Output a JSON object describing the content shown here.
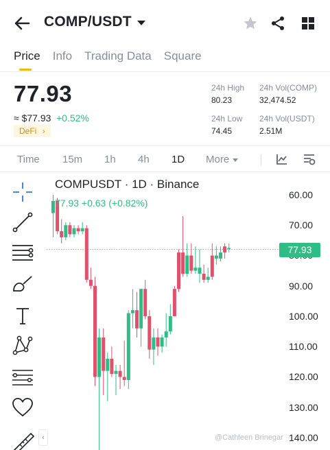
{
  "header": {
    "pair": "COMP/USDT",
    "icons": [
      "back-arrow-icon",
      "caret-down-icon",
      "star-icon",
      "share-icon",
      "grid-icon"
    ]
  },
  "tabs": [
    "Price",
    "Info",
    "Trading Data",
    "Square"
  ],
  "ticker": {
    "last_price": "77.93",
    "fiat_price": "≈ $77.93",
    "change_pct": "+0.52%",
    "tag": "DeFi",
    "high_label": "24h High",
    "high_value": "80.23",
    "low_label": "24h Low",
    "low_value": "74.45",
    "vol_base_label": "24h Vol(COMP)",
    "vol_base_value": "32,474.52",
    "vol_quote_label": "24h Vol(USDT)",
    "vol_quote_value": "2.51M"
  },
  "intervals": [
    "Time",
    "15m",
    "1h",
    "4h",
    "1D",
    "More"
  ],
  "active_interval": "1D",
  "tools": [
    "crosshair-icon",
    "trend-line-icon",
    "horizontal-lines-icon",
    "brush-icon",
    "text-icon",
    "pattern-icon",
    "fib-icon",
    "heart-icon",
    "ruler-icon"
  ],
  "chart": {
    "title": "COMPUSDT · 1D · Binance",
    "subtitle": "77.93 +0.63 (+0.82%)",
    "current_price_tag": "77.93",
    "y_ticks": [
      "60.00",
      "70.00",
      "80.00",
      "90.00",
      "100.00",
      "110.00",
      "120.00",
      "130.00",
      "140.00"
    ],
    "watermark": "@Cathleen Brinegar",
    "colors": {
      "up": "#2ebd85",
      "down": "#e0526b",
      "accent": "#f0b90b"
    }
  },
  "chart_data": {
    "type": "candlestick",
    "title": "COMPUSDT · 1D · Binance",
    "ylim": [
      140,
      57
    ],
    "y_inverted": true,
    "current": 77.93,
    "candles": [
      {
        "o": 66,
        "h": 60,
        "l": 74,
        "c": 62,
        "up": true
      },
      {
        "o": 62,
        "h": 61,
        "l": 73,
        "c": 72,
        "up": false
      },
      {
        "o": 72,
        "h": 68,
        "l": 76,
        "c": 74,
        "up": false
      },
      {
        "o": 74,
        "h": 69,
        "l": 75,
        "c": 70,
        "up": true
      },
      {
        "o": 70,
        "h": 69,
        "l": 74,
        "c": 73,
        "up": false
      },
      {
        "o": 73,
        "h": 70,
        "l": 74,
        "c": 71,
        "up": true
      },
      {
        "o": 71,
        "h": 70,
        "l": 73,
        "c": 72,
        "up": false
      },
      {
        "o": 72,
        "h": 69,
        "l": 73,
        "c": 71,
        "up": true
      },
      {
        "o": 71,
        "h": 70,
        "l": 89,
        "c": 88,
        "up": false
      },
      {
        "o": 88,
        "h": 84,
        "l": 91,
        "c": 90,
        "up": false
      },
      {
        "o": 90,
        "h": 87,
        "l": 123,
        "c": 120,
        "up": false
      },
      {
        "o": 120,
        "h": 104,
        "l": 146,
        "c": 107,
        "up": true
      },
      {
        "o": 107,
        "h": 104,
        "l": 126,
        "c": 118,
        "up": false
      },
      {
        "o": 118,
        "h": 112,
        "l": 128,
        "c": 114,
        "up": true
      },
      {
        "o": 114,
        "h": 110,
        "l": 120,
        "c": 119,
        "up": false
      },
      {
        "o": 119,
        "h": 116,
        "l": 126,
        "c": 118,
        "up": true
      },
      {
        "o": 118,
        "h": 116,
        "l": 124,
        "c": 120,
        "up": false
      },
      {
        "o": 120,
        "h": 108,
        "l": 123,
        "c": 121,
        "up": false
      },
      {
        "o": 121,
        "h": 98,
        "l": 124,
        "c": 99,
        "up": true
      },
      {
        "o": 99,
        "h": 91,
        "l": 104,
        "c": 98,
        "up": true
      },
      {
        "o": 98,
        "h": 92,
        "l": 107,
        "c": 104,
        "up": false
      },
      {
        "o": 104,
        "h": 96,
        "l": 110,
        "c": 91,
        "up": true
      },
      {
        "o": 91,
        "h": 88,
        "l": 101,
        "c": 100,
        "up": false
      },
      {
        "o": 100,
        "h": 98,
        "l": 114,
        "c": 111,
        "up": false
      },
      {
        "o": 111,
        "h": 104,
        "l": 116,
        "c": 107,
        "up": true
      },
      {
        "o": 107,
        "h": 104,
        "l": 113,
        "c": 110,
        "up": false
      },
      {
        "o": 110,
        "h": 106,
        "l": 112,
        "c": 107,
        "up": true
      },
      {
        "o": 107,
        "h": 99,
        "l": 110,
        "c": 105,
        "up": true
      },
      {
        "o": 105,
        "h": 96,
        "l": 106,
        "c": 100,
        "up": true
      },
      {
        "o": 100,
        "h": 90,
        "l": 100,
        "c": 91,
        "up": false
      },
      {
        "o": 91,
        "h": 78,
        "l": 92,
        "c": 79,
        "up": false
      },
      {
        "o": 79,
        "h": 67,
        "l": 87,
        "c": 86,
        "up": false
      },
      {
        "o": 86,
        "h": 76,
        "l": 87,
        "c": 80,
        "up": true
      },
      {
        "o": 80,
        "h": 76,
        "l": 86,
        "c": 85,
        "up": false
      },
      {
        "o": 85,
        "h": 77,
        "l": 86,
        "c": 84,
        "up": true
      },
      {
        "o": 84,
        "h": 78,
        "l": 89,
        "c": 86,
        "up": true
      },
      {
        "o": 86,
        "h": 83,
        "l": 89,
        "c": 88,
        "up": false
      },
      {
        "o": 88,
        "h": 84,
        "l": 89,
        "c": 87,
        "up": true
      },
      {
        "o": 87,
        "h": 76,
        "l": 88,
        "c": 80,
        "up": false
      },
      {
        "o": 80,
        "h": 77,
        "l": 83,
        "c": 81,
        "up": true
      },
      {
        "o": 81,
        "h": 77,
        "l": 82,
        "c": 79,
        "up": true
      },
      {
        "o": 79,
        "h": 76,
        "l": 81,
        "c": 77,
        "up": false
      },
      {
        "o": 77.5,
        "h": 76,
        "l": 79,
        "c": 77.9,
        "up": true
      }
    ]
  }
}
